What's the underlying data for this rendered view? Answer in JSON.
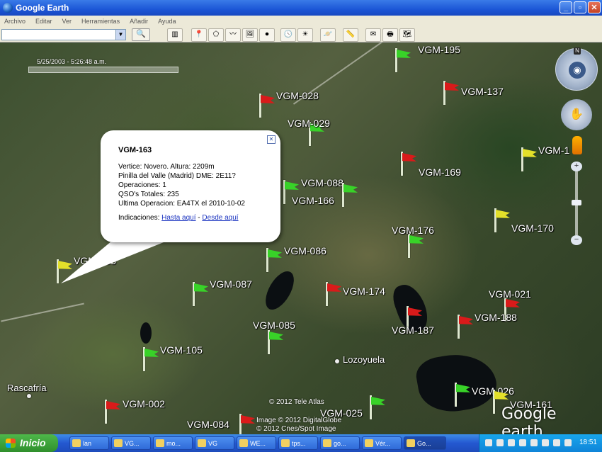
{
  "window": {
    "title": "Google Earth",
    "buttons": [
      "_",
      "▫",
      "✕"
    ]
  },
  "menu": [
    "Archivo",
    "Editar",
    "Ver",
    "Herramientas",
    "Añadir",
    "Ayuda"
  ],
  "toolbar": {
    "search_placeholder": "",
    "search_go": "🔍"
  },
  "map": {
    "timeline_date": "5/25/2003 - 5:26:48 a.m.",
    "flags": [
      {
        "label": "VGM-195",
        "color": "green"
      },
      {
        "label": "VGM-137",
        "color": "red"
      },
      {
        "label": "VGM-028",
        "color": "red"
      },
      {
        "label": "VGM-029",
        "color": "green"
      },
      {
        "label": "VGM-1",
        "color": "yellow"
      },
      {
        "label": "VGM-169",
        "color": "red"
      },
      {
        "label": "VGM-088",
        "color": "green"
      },
      {
        "label": "VGM-166",
        "color": "green"
      },
      {
        "label": "VGM-170",
        "color": "yellow"
      },
      {
        "label": "VGM-176",
        "color": "green"
      },
      {
        "label": "VGM-086",
        "color": "green"
      },
      {
        "label": "VGM-163",
        "color": "yellow"
      },
      {
        "label": "VGM-087",
        "color": "green"
      },
      {
        "label": "VGM-174",
        "color": "red"
      },
      {
        "label": "VGM-021",
        "color": "red"
      },
      {
        "label": "VGM-188",
        "color": "red"
      },
      {
        "label": "VGM-187",
        "color": "red"
      },
      {
        "label": "VGM-085",
        "color": "green"
      },
      {
        "label": "VGM-105",
        "color": "green"
      },
      {
        "label": "VGM-026",
        "color": "green"
      },
      {
        "label": "VGM-161",
        "color": "yellow"
      },
      {
        "label": "VGM-002",
        "color": "red"
      },
      {
        "label": "VGM-025",
        "color": "green"
      },
      {
        "label": "VGM-084",
        "color": "red"
      }
    ],
    "towns": [
      "Lozoyuela",
      "Rascafría"
    ],
    "credits": [
      "© 2012 Tele Atlas",
      "Image © 2012 DigitalGlobe",
      "© 2012 Cnes/Spot Image"
    ],
    "logo_google": "Google",
    "logo_earth": "earth",
    "nav_north": "N"
  },
  "popup": {
    "title": "VGM-163",
    "lines": [
      "Vertice: Novero. Altura: 2209m",
      "Pinilla del Valle (Madrid) DME: 2E11?",
      "Operaciones: 1",
      "QSO's Totales: 235",
      "Ultima Operacion: EA4TX el 2010-10-02"
    ],
    "links_prefix": "Indicaciones: ",
    "link_to": "Hasta aquí",
    "link_sep": " - ",
    "link_from": "Desde aquí",
    "close": "✕"
  },
  "taskbar": {
    "start": "Inicio",
    "tasks": [
      "lan",
      "VG...",
      "mo...",
      "VG",
      "WE...",
      "tps...",
      "go...",
      "Vér...",
      "Go..."
    ],
    "clock": "18:51"
  }
}
